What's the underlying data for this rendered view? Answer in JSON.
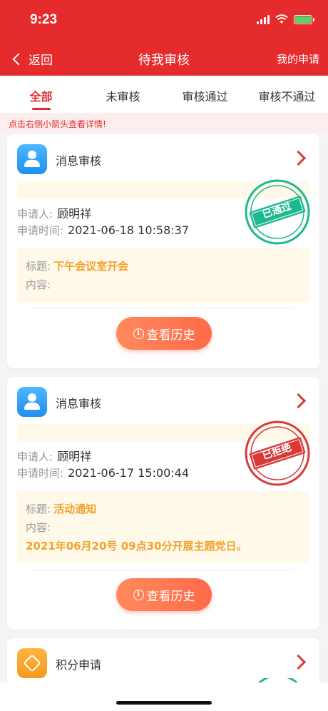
{
  "status_bar": {
    "time": "9:23"
  },
  "nav": {
    "back_label": "返回",
    "title": "待我审核",
    "right_label": "我的申请"
  },
  "tabs": [
    {
      "label": "全部",
      "active": true
    },
    {
      "label": "未审核",
      "active": false
    },
    {
      "label": "审核通过",
      "active": false
    },
    {
      "label": "审核不通过",
      "active": false
    }
  ],
  "hint": "点击右侧小箭头查看详情!",
  "labels": {
    "applicant": "申请人:",
    "apply_time": "申请时间:",
    "subject": "标题:",
    "content": "内容:",
    "history_button": "查看历史"
  },
  "cards": [
    {
      "type_name": "消息审核",
      "icon": "user-icon",
      "applicant": "顾明祥",
      "apply_time": "2021-06-18 10:58:37",
      "subject": "下午会议室开会",
      "content": "",
      "stamp": {
        "text": "已通过",
        "color": "#1db890"
      }
    },
    {
      "type_name": "消息审核",
      "icon": "user-icon",
      "applicant": "顾明祥",
      "apply_time": "2021-06-17 15:00:44",
      "subject": "活动通知",
      "content": "2021年06月20号 09点30分开展主题党日。",
      "stamp": {
        "text": "已拒绝",
        "color": "#d83a3a"
      }
    },
    {
      "type_name": "积分申请",
      "icon": "points-icon"
    }
  ],
  "colors": {
    "primary": "#e52b2b",
    "accent": "#f2a12c",
    "button": "#ff6a4a"
  }
}
